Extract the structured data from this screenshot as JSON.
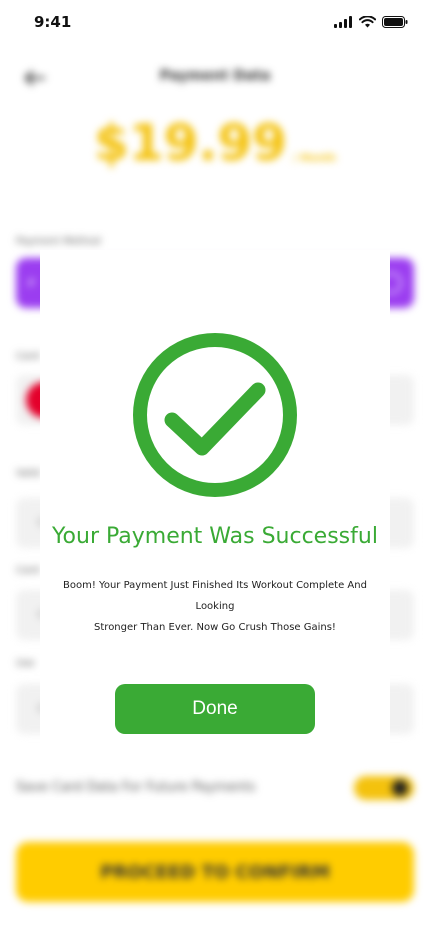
{
  "status_bar": {
    "time": "9:41"
  },
  "header": {
    "title": "Payment Data",
    "back_icon": "arrow-left-icon"
  },
  "price": {
    "amount": "$19.99",
    "period": "/ Month"
  },
  "form": {
    "payment_method_label": "Payment Method",
    "card_label": "Card",
    "valid_label": "Valid",
    "card_holder_label": "Card",
    "use_label": "Use",
    "save_card_label": "Save Card Data For Future Payments",
    "save_card_enabled": true
  },
  "proceed_button": {
    "label": "PROCEED TO CONFIRM"
  },
  "modal": {
    "icon": "check-circle-icon",
    "title": "Your Payment Was Successful",
    "message_line1": "Boom! Your Payment Just Finished Its Workout Complete And Looking",
    "message_line2": "Stronger Than Ever. Now Go Crush Those Gains!",
    "done_label": "Done"
  },
  "colors": {
    "success": "#3aaa35",
    "accent_yellow": "#ffcc00",
    "purple": "#9b3df0"
  }
}
